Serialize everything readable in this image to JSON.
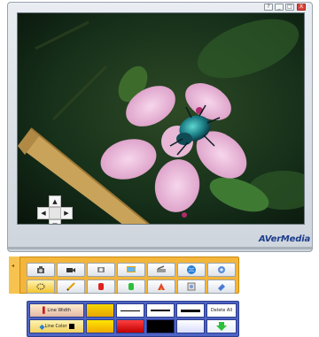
{
  "window": {
    "controls": [
      "?",
      "_",
      "□",
      "X"
    ]
  },
  "viewer": {
    "brand": "AVerMedia",
    "brand_reg": "®",
    "dpad": {
      "up": "▲",
      "down": "▼",
      "left": "◀",
      "right": "▶"
    }
  },
  "toolbar": {
    "collapse_glyph": "◂",
    "row1": [
      "camera-icon",
      "video-camera-icon",
      "snapshot-icon",
      "monitor-icon",
      "scanner-icon",
      "globe-icon",
      "gear-icon"
    ],
    "row2": [
      "lasso-icon",
      "pencil-icon",
      "red-shape-icon",
      "green-shape-icon",
      "draw-tool-icon",
      "image-icon",
      "eraser-icon"
    ]
  },
  "drawing": {
    "line_width_label": "Line Width",
    "line_color_label": "Line Color",
    "delete_all_label": "Delete All",
    "colors": {
      "accent_orange": "#f3b53a",
      "panel_blue": "#4e63c4",
      "swatch_yellow": "#f6d800",
      "swatch_red": "#e02020",
      "swatch_black": "#000000",
      "swatch_white": "#ffffff",
      "swatch_blue": "#3a4fd0",
      "swatch_green": "#2bbf3a"
    }
  }
}
